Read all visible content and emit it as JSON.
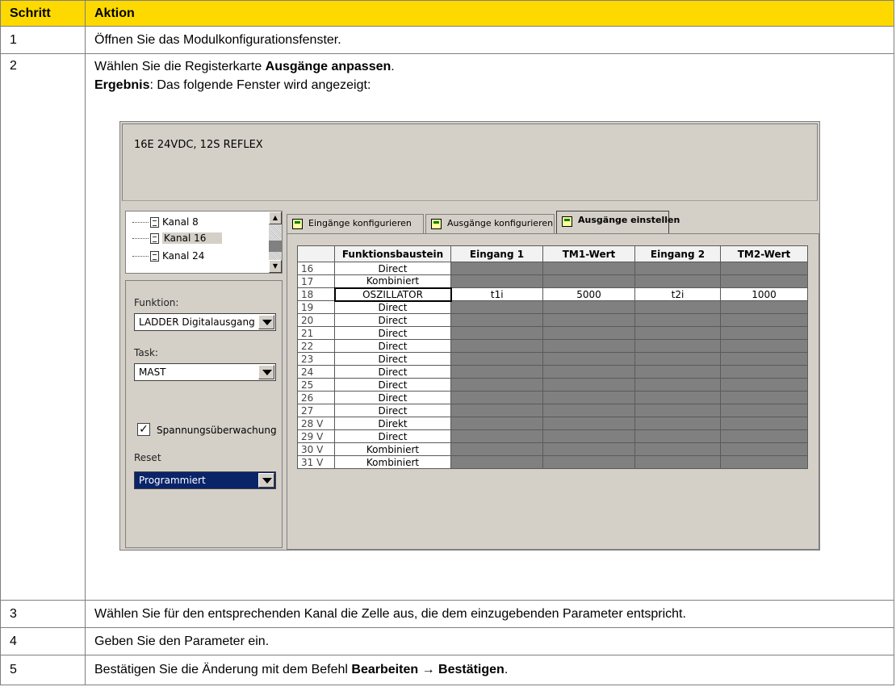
{
  "headers": {
    "col1": "Schritt",
    "col2": "Aktion"
  },
  "rows": [
    {
      "num": "1",
      "text": "Öffnen Sie das Modulkonfigurationsfenster."
    },
    {
      "num": "2",
      "line1_pre": "Wählen Sie die Registerkarte ",
      "line1_bold": "Ausgänge anpassen",
      "line1_post": ".",
      "line2_bold": "Ergebnis",
      "line2_post": ": Das folgende Fenster wird angezeigt:"
    },
    {
      "num": "3",
      "text": "Wählen Sie für den entsprechenden Kanal die Zelle aus, die dem einzugebenden Parameter entspricht."
    },
    {
      "num": "4",
      "text": "Geben Sie den Parameter ein."
    },
    {
      "num": "5",
      "pre": "Bestätigen Sie die Änderung mit dem Befehl ",
      "bold": "Bearbeiten → Bestätigen",
      "post": "."
    }
  ],
  "window": {
    "module_title": "16E 24VDC, 12S REFLEX",
    "tree": [
      "Kanal 8",
      "Kanal 16",
      "Kanal 24"
    ],
    "funktion_label": "Funktion:",
    "funktion_value": "LADDER Digitalausgang",
    "task_label": "Task:",
    "task_value": "MAST",
    "checkbox_label": "Spannungsüberwachung",
    "checkbox_mark": "✓",
    "reset_label": "Reset",
    "reset_value": "Programmiert",
    "tabs": [
      "Eingänge konfigurieren",
      "Ausgänge konfigurieren",
      "Ausgänge einstellen"
    ],
    "grid_headers": [
      "Funktionsbaustein",
      "Eingang 1",
      "TM1-Wert",
      "Eingang 2",
      "TM2-Wert"
    ],
    "grid_rows": [
      {
        "ch": "16",
        "fb": "Direct"
      },
      {
        "ch": "17",
        "fb": "Kombiniert"
      },
      {
        "ch": "18",
        "fb": "OSZILLATOR",
        "in1": "t1i",
        "tm1": "5000",
        "in2": "t2i",
        "tm2": "1000"
      },
      {
        "ch": "19",
        "fb": "Direct"
      },
      {
        "ch": "20",
        "fb": "Direct"
      },
      {
        "ch": "21",
        "fb": "Direct"
      },
      {
        "ch": "22",
        "fb": "Direct"
      },
      {
        "ch": "23",
        "fb": "Direct"
      },
      {
        "ch": "24",
        "fb": "Direct"
      },
      {
        "ch": "25",
        "fb": "Direct"
      },
      {
        "ch": "26",
        "fb": "Direct"
      },
      {
        "ch": "27",
        "fb": "Direct"
      },
      {
        "ch": "28 V",
        "fb": "Direkt"
      },
      {
        "ch": "29 V",
        "fb": "Direct"
      },
      {
        "ch": "30 V",
        "fb": "Kombiniert"
      },
      {
        "ch": "31 V",
        "fb": "Kombiniert"
      }
    ]
  }
}
